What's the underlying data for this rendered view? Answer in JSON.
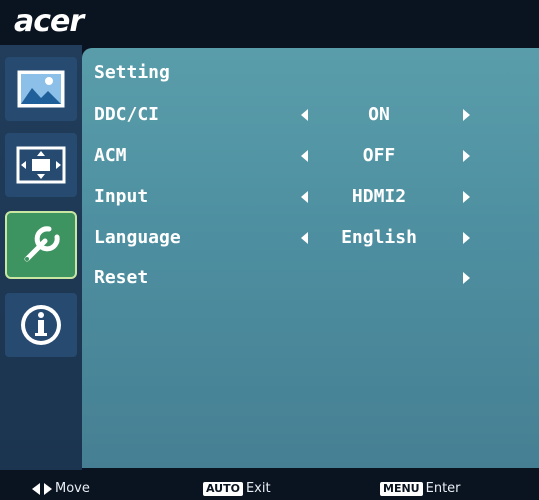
{
  "brand": "acer",
  "sidebar": {
    "items": [
      {
        "name": "picture",
        "icon": "picture-icon"
      },
      {
        "name": "display",
        "icon": "display-position-icon"
      },
      {
        "name": "setting",
        "icon": "wrench-icon",
        "active": true
      },
      {
        "name": "information",
        "icon": "info-icon"
      }
    ]
  },
  "panel": {
    "title": "Setting",
    "rows": [
      {
        "label": "DDC/CI",
        "value": "ON"
      },
      {
        "label": "ACM",
        "value": "OFF"
      },
      {
        "label": "Input",
        "value": "HDMI2"
      },
      {
        "label": "Language",
        "value": "English"
      },
      {
        "label": "Reset",
        "value": ""
      }
    ]
  },
  "footer": {
    "move_label": "Move",
    "auto_key": "AUTO",
    "exit_label": "Exit",
    "menu_key": "MENU",
    "enter_label": "Enter"
  },
  "colors": {
    "panel": "#5a9daa",
    "sidebar": "#213d5b",
    "active_button": "#3d9460",
    "background": "#0a1320"
  }
}
